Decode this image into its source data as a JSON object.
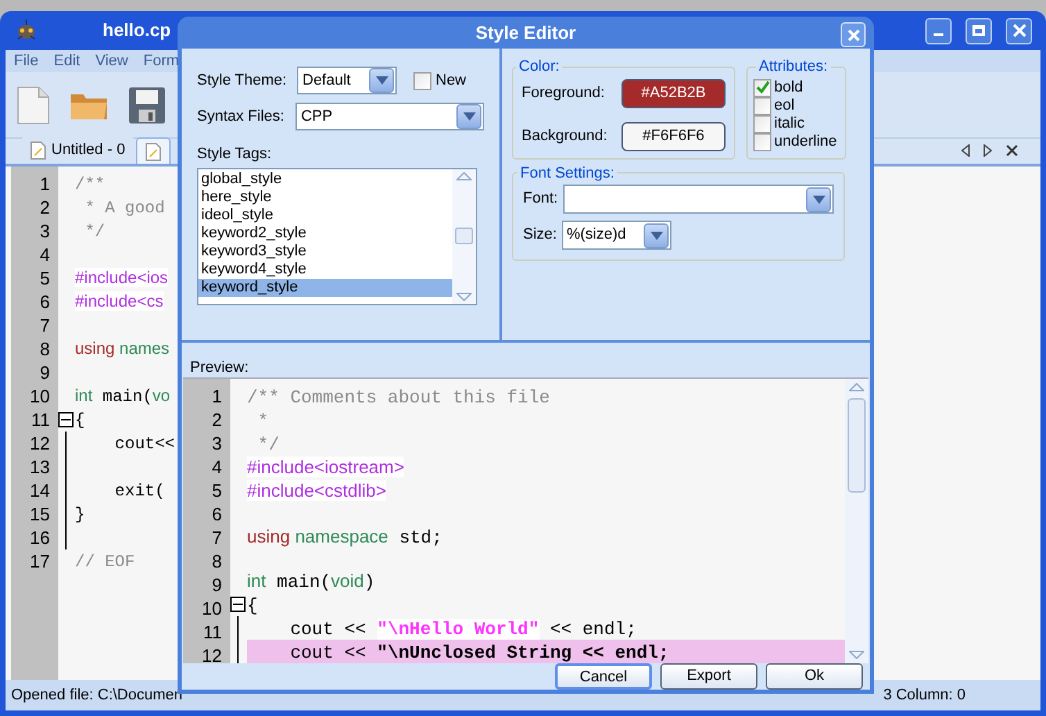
{
  "app": {
    "title": "hello.cp",
    "menu": [
      "File",
      "Edit",
      "View",
      "Form"
    ],
    "tabs": [
      {
        "label": "Untitled - 0",
        "selected": false
      },
      {
        "selected": true
      }
    ],
    "editor_lines": [
      {
        "number": "1",
        "fold": false,
        "tokens": [
          {
            "kind": "comment",
            "text": "/**"
          }
        ]
      },
      {
        "number": "2",
        "fold": false,
        "tokens": [
          {
            "kind": "comment",
            "text": " * A good"
          }
        ]
      },
      {
        "number": "3",
        "fold": false,
        "tokens": [
          {
            "kind": "comment",
            "text": " */"
          }
        ]
      },
      {
        "number": "4",
        "fold": false
      },
      {
        "number": "5",
        "fold": false,
        "tokens": [
          {
            "kind": "preproc",
            "text": "#include<ios"
          }
        ]
      },
      {
        "number": "6",
        "fold": false,
        "tokens": [
          {
            "kind": "preproc",
            "text": "#include<cs"
          }
        ]
      },
      {
        "number": "7",
        "fold": false
      },
      {
        "number": "8",
        "fold": false,
        "tokens": [
          {
            "kind": "keyword",
            "text": "using"
          },
          {
            "kind": "type",
            "text": " names"
          }
        ]
      },
      {
        "number": "9",
        "fold": false
      },
      {
        "number": "10",
        "fold": false,
        "tokens": [
          {
            "kind": "type",
            "text": "int"
          },
          {
            "kind": "plain",
            "text": " main("
          },
          {
            "kind": "type",
            "text": "vo"
          }
        ]
      },
      {
        "number": "11",
        "fold": true,
        "tokens": [
          {
            "kind": "plain",
            "text": "{"
          }
        ]
      },
      {
        "number": "12",
        "fold": false,
        "tokens": [
          {
            "kind": "plain",
            "text": "    cout<<"
          }
        ]
      },
      {
        "number": "13",
        "fold": false
      },
      {
        "number": "14",
        "fold": false,
        "tokens": [
          {
            "kind": "plain",
            "text": "    exit("
          }
        ]
      },
      {
        "number": "15",
        "fold": false,
        "tokens": [
          {
            "kind": "plain",
            "text": "}"
          }
        ]
      },
      {
        "number": "16",
        "fold": false
      },
      {
        "number": "17",
        "fold": false,
        "tokens": [
          {
            "kind": "comment",
            "text": "// EOF"
          }
        ]
      }
    ],
    "status_left": "Opened file: C:\\Documen",
    "status_right": "3  Column: 0"
  },
  "dialog": {
    "title": "Style Editor",
    "theme": {
      "label": "Style Theme:",
      "value": "Default"
    },
    "new_checkbox": {
      "label": "New",
      "checked": false
    },
    "syntax": {
      "label": "Syntax Files:",
      "value": "CPP"
    },
    "tags_label": "Style Tags:",
    "tags": [
      {
        "label": "global_style",
        "selected": false
      },
      {
        "label": "here_style",
        "selected": false
      },
      {
        "label": "ideol_style",
        "selected": false
      },
      {
        "label": "keyword2_style",
        "selected": false
      },
      {
        "label": "keyword3_style",
        "selected": false
      },
      {
        "label": "keyword4_style",
        "selected": false
      },
      {
        "label": "keyword_style",
        "selected": true
      }
    ],
    "color_group": "Color:",
    "foreground": {
      "label": "Foreground:",
      "value": "#A52B2B",
      "color": "#a52b2b"
    },
    "background": {
      "label": "Background:",
      "value": "#F6F6F6",
      "color": "#f6f6f6"
    },
    "attributes_group": "Attributes:",
    "attributes": [
      {
        "label": "bold",
        "checked": true
      },
      {
        "label": "eol",
        "checked": false
      },
      {
        "label": "italic",
        "checked": false
      },
      {
        "label": "underline",
        "checked": false
      }
    ],
    "font_group": "Font Settings:",
    "font": {
      "label": "Font:"
    },
    "size": {
      "label": "Size:",
      "value": "%(size)d"
    },
    "preview_label": "Preview:",
    "preview_lines": [
      {
        "number": "1",
        "fold": false,
        "eol": false,
        "tokens": [
          {
            "kind": "comment",
            "text": "/** Comments about this file"
          }
        ]
      },
      {
        "number": "2",
        "fold": false,
        "eol": false,
        "tokens": [
          {
            "kind": "comment",
            "text": " *"
          }
        ]
      },
      {
        "number": "3",
        "fold": false,
        "eol": false,
        "tokens": [
          {
            "kind": "comment",
            "text": " */"
          }
        ]
      },
      {
        "number": "4",
        "fold": false,
        "eol": false,
        "tokens": [
          {
            "kind": "preproc",
            "text": "#include<iostream>"
          }
        ]
      },
      {
        "number": "5",
        "fold": false,
        "eol": false,
        "tokens": [
          {
            "kind": "preproc",
            "text": "#include<cstdlib>"
          }
        ]
      },
      {
        "number": "6",
        "fold": false,
        "eol": false
      },
      {
        "number": "7",
        "fold": false,
        "eol": false,
        "tokens": [
          {
            "kind": "keyword",
            "text": "using"
          },
          {
            "kind": "type",
            "text": " namespace"
          },
          {
            "kind": "plain",
            "text": " std;"
          }
        ]
      },
      {
        "number": "8",
        "fold": false,
        "eol": false
      },
      {
        "number": "9",
        "fold": false,
        "eol": false,
        "tokens": [
          {
            "kind": "type",
            "text": "int"
          },
          {
            "kind": "plain",
            "text": " main("
          },
          {
            "kind": "type",
            "text": "void"
          },
          {
            "kind": "plain",
            "text": ")"
          }
        ]
      },
      {
        "number": "10",
        "fold": true,
        "eol": false,
        "tokens": [
          {
            "kind": "plain",
            "text": "{"
          }
        ]
      },
      {
        "number": "11",
        "fold": false,
        "eol": false,
        "tokens": [
          {
            "kind": "plain",
            "text": "    cout << "
          },
          {
            "kind": "string",
            "text": "\"\\nHello World\""
          },
          {
            "kind": "plain",
            "text": " << endl;"
          }
        ]
      },
      {
        "number": "12",
        "fold": false,
        "eol": true,
        "tokens": [
          {
            "kind": "plain",
            "text": "    cout << "
          },
          {
            "kind": "unclosed",
            "text": "\"\\nUnclosed String << endl;"
          }
        ]
      }
    ],
    "buttons": [
      {
        "label": "Cancel",
        "selected": true
      },
      {
        "label": "Export",
        "selected": false
      },
      {
        "label": "Ok",
        "selected": false
      }
    ]
  }
}
